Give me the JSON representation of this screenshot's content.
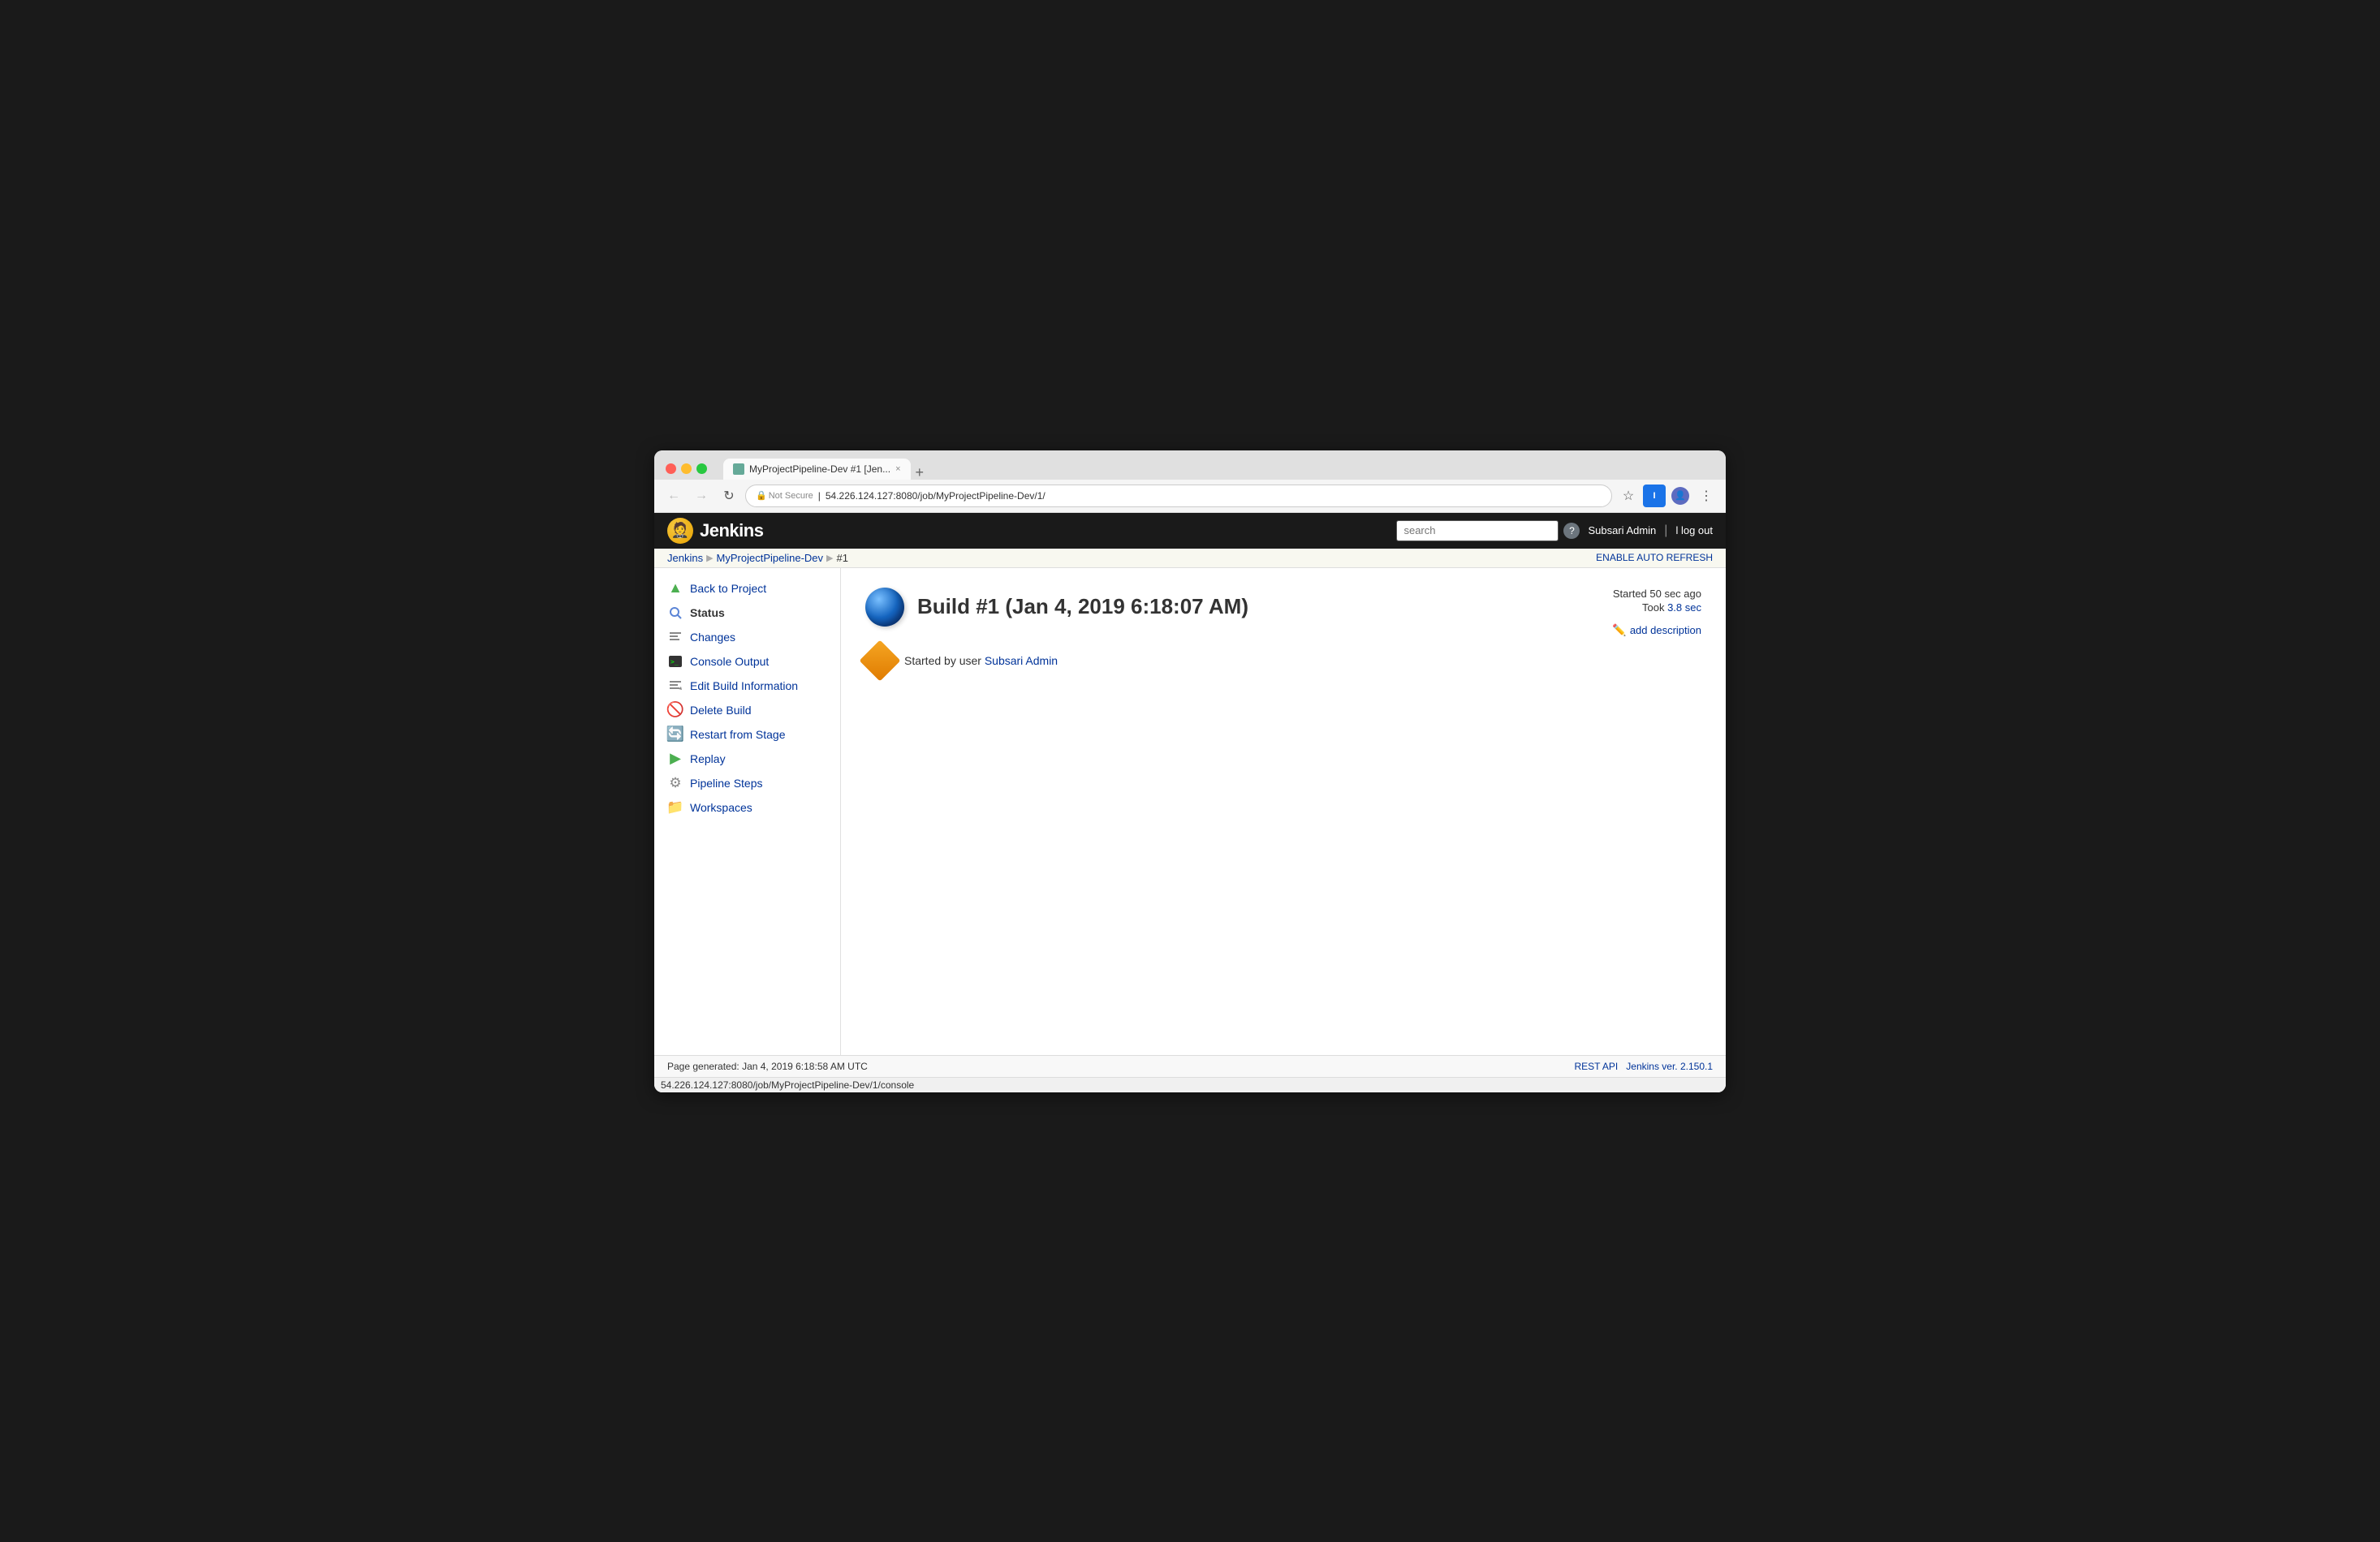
{
  "browser": {
    "tab_title": "MyProjectPipeline-Dev #1 [Jen...",
    "tab_close": "×",
    "tab_new": "+",
    "nav_back": "←",
    "nav_forward": "→",
    "nav_refresh": "↻",
    "not_secure_label": "Not Secure",
    "address": "54.226.124.127:8080/job/MyProjectPipeline-Dev/1/",
    "bookmark_icon": "☆",
    "extensions_label": "I",
    "more_icon": "⋮"
  },
  "jenkins": {
    "logo_text": "Jenkins",
    "search_placeholder": "search",
    "help_icon": "?",
    "user_name": "Subsari Admin",
    "logout_label": "l log out"
  },
  "breadcrumb": {
    "jenkins_label": "Jenkins",
    "pipeline_label": "MyProjectPipeline-Dev",
    "build_label": "#1",
    "enable_refresh_label": "ENABLE AUTO REFRESH"
  },
  "sidebar": {
    "items": [
      {
        "id": "back-to-project",
        "label": "Back to Project",
        "icon": "▲",
        "icon_type": "back"
      },
      {
        "id": "status",
        "label": "Status",
        "icon": "🔍",
        "icon_type": "status",
        "active": true
      },
      {
        "id": "changes",
        "label": "Changes",
        "icon": "✏️",
        "icon_type": "changes"
      },
      {
        "id": "console-output",
        "label": "Console Output",
        "icon": "🖥",
        "icon_type": "console"
      },
      {
        "id": "edit-build-info",
        "label": "Edit Build Information",
        "icon": "✏️",
        "icon_type": "edit"
      },
      {
        "id": "delete-build",
        "label": "Delete Build",
        "icon": "🚫",
        "icon_type": "delete"
      },
      {
        "id": "restart-from-stage",
        "label": "Restart from Stage",
        "icon": "🔄",
        "icon_type": "restart"
      },
      {
        "id": "replay",
        "label": "Replay",
        "icon": "▶",
        "icon_type": "replay"
      },
      {
        "id": "pipeline-steps",
        "label": "Pipeline Steps",
        "icon": "⚙",
        "icon_type": "pipeline"
      },
      {
        "id": "workspaces",
        "label": "Workspaces",
        "icon": "📁",
        "icon_type": "workspace"
      }
    ]
  },
  "main": {
    "build_title": "Build #1 (Jan 4, 2019 6:18:07 AM)",
    "started_label": "Started 50 sec ago",
    "took_label": "Took",
    "took_duration": "3.8 sec",
    "add_description_label": "add description",
    "trigger_text": "Started by user",
    "trigger_user": "Subsari Admin"
  },
  "footer": {
    "page_generated": "Page generated: Jan 4, 2019 6:18:58 AM UTC",
    "rest_api_label": "REST API",
    "jenkins_ver_label": "Jenkins ver. 2.150.1"
  },
  "status_bar": {
    "url": "54.226.124.127:8080/job/MyProjectPipeline-Dev/1/console"
  }
}
